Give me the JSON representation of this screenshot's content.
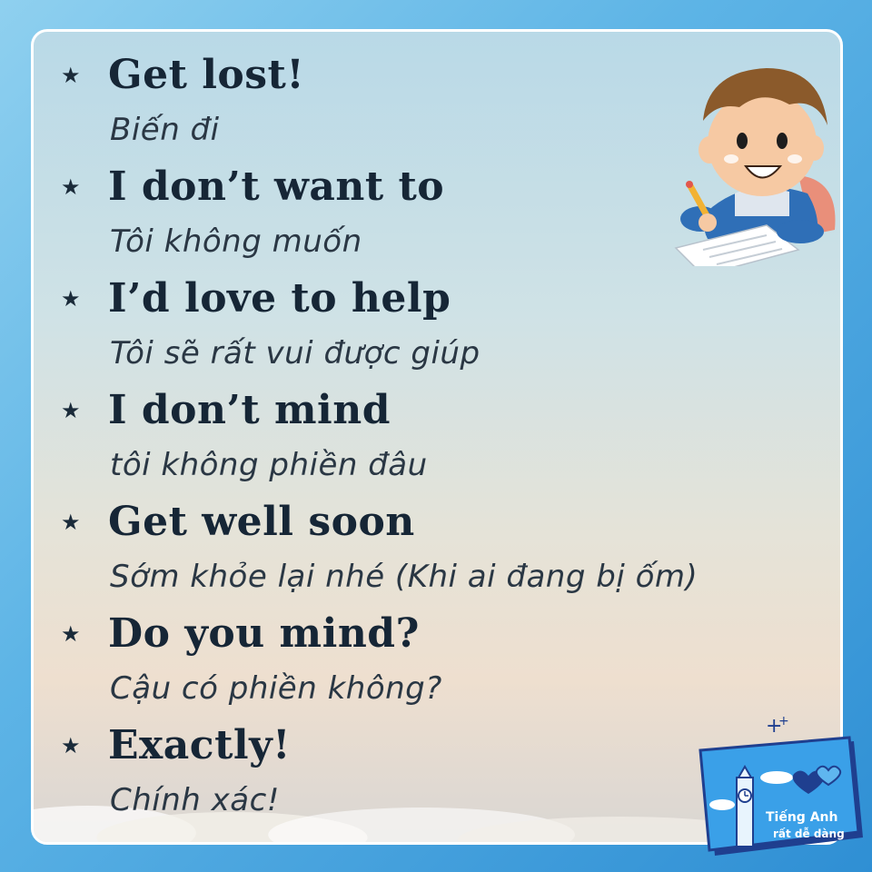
{
  "phrases": [
    {
      "english": "Get lost!",
      "vietnamese": "Biến đi"
    },
    {
      "english": "I don’t want to",
      "vietnamese": "Tôi không muốn"
    },
    {
      "english": "I’d love to help",
      "vietnamese": "Tôi sẽ rất vui được giúp"
    },
    {
      "english": "I don’t mind",
      "vietnamese": "tôi không phiền đâu"
    },
    {
      "english": "Get well soon",
      "vietnamese": "Sớm khỏe lại nhé (Khi ai đang bị ốm)"
    },
    {
      "english": "Do you mind?",
      "vietnamese": "Cậu có phiền không?"
    },
    {
      "english": "Exactly!",
      "vietnamese": "Chính xác!"
    }
  ],
  "bullet_symbol": "★",
  "logo": {
    "line1": "Tiếng Anh",
    "line2": "rất dễ dàng"
  },
  "colors": {
    "frame_blue": "#2f8fd4",
    "text_dark": "#162636",
    "logo_blue": "#3aa0e8"
  },
  "icons": {
    "mascot": "boy-writing-illustration",
    "logo": "big-ben-hearts-logo"
  }
}
